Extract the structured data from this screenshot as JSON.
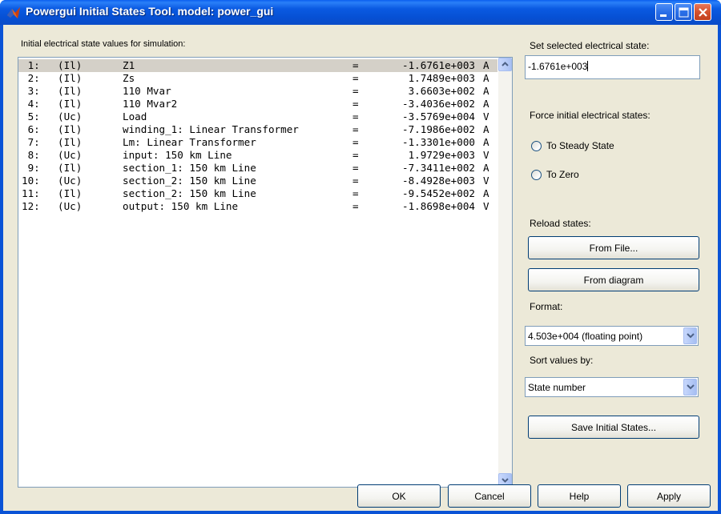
{
  "window": {
    "title": "Powergui Initial States Tool. model: power_gui"
  },
  "list": {
    "header": "Initial electrical state values for simulation:",
    "rows": [
      {
        "num": " 1:",
        "type": "(Il)",
        "name": "Z1",
        "eq": "=",
        "value": "-1.6761e+003",
        "unit": "A",
        "selected": true
      },
      {
        "num": " 2:",
        "type": "(Il)",
        "name": "Zs",
        "eq": "=",
        "value": "1.7489e+003",
        "unit": "A"
      },
      {
        "num": " 3:",
        "type": "(Il)",
        "name": "110 Mvar",
        "eq": "=",
        "value": "3.6603e+002",
        "unit": "A"
      },
      {
        "num": " 4:",
        "type": "(Il)",
        "name": "110 Mvar2",
        "eq": "=",
        "value": "-3.4036e+002",
        "unit": "A"
      },
      {
        "num": " 5:",
        "type": "(Uc)",
        "name": "Load",
        "eq": "=",
        "value": "-3.5769e+004",
        "unit": "V"
      },
      {
        "num": " 6:",
        "type": "(Il)",
        "name": "winding_1: Linear Transformer",
        "eq": "=",
        "value": "-7.1986e+002",
        "unit": "A"
      },
      {
        "num": " 7:",
        "type": "(Il)",
        "name": "Lm: Linear Transformer",
        "eq": "=",
        "value": "-1.3301e+000",
        "unit": "A"
      },
      {
        "num": " 8:",
        "type": "(Uc)",
        "name": "input: 150 km Line",
        "eq": "=",
        "value": "1.9729e+003",
        "unit": "V"
      },
      {
        "num": " 9:",
        "type": "(Il)",
        "name": "section_1: 150 km Line",
        "eq": "=",
        "value": "-7.3411e+002",
        "unit": "A"
      },
      {
        "num": "10:",
        "type": "(Uc)",
        "name": "section_2: 150 km Line",
        "eq": "=",
        "value": "-8.4928e+003",
        "unit": "V"
      },
      {
        "num": "11:",
        "type": "(Il)",
        "name": "section_2: 150 km Line",
        "eq": "=",
        "value": "-9.5452e+002",
        "unit": "A"
      },
      {
        "num": "12:",
        "type": "(Uc)",
        "name": "output: 150 km Line",
        "eq": "=",
        "value": "-1.8698e+004",
        "unit": "V"
      }
    ]
  },
  "side": {
    "set_label": "Set selected electrical state:",
    "set_value": "-1.6761e+003",
    "force_label": "Force initial electrical states:",
    "radio_steady": "To Steady State",
    "radio_zero": "To Zero",
    "reload_label": "Reload states:",
    "from_file": "From File...",
    "from_diagram": "From diagram",
    "format_label": "Format:",
    "format_value": "4.503e+004 (floating point)",
    "sort_label": "Sort values by:",
    "sort_value": "State number",
    "save_states": "Save Initial States..."
  },
  "footer": {
    "ok": "OK",
    "cancel": "Cancel",
    "help": "Help",
    "apply": "Apply"
  },
  "colors": {
    "titlebar": "#0a5ae2",
    "client_bg": "#ece9d8",
    "selection": "#d4d0c8",
    "field_border": "#7f9db9",
    "button_border": "#003c74"
  }
}
